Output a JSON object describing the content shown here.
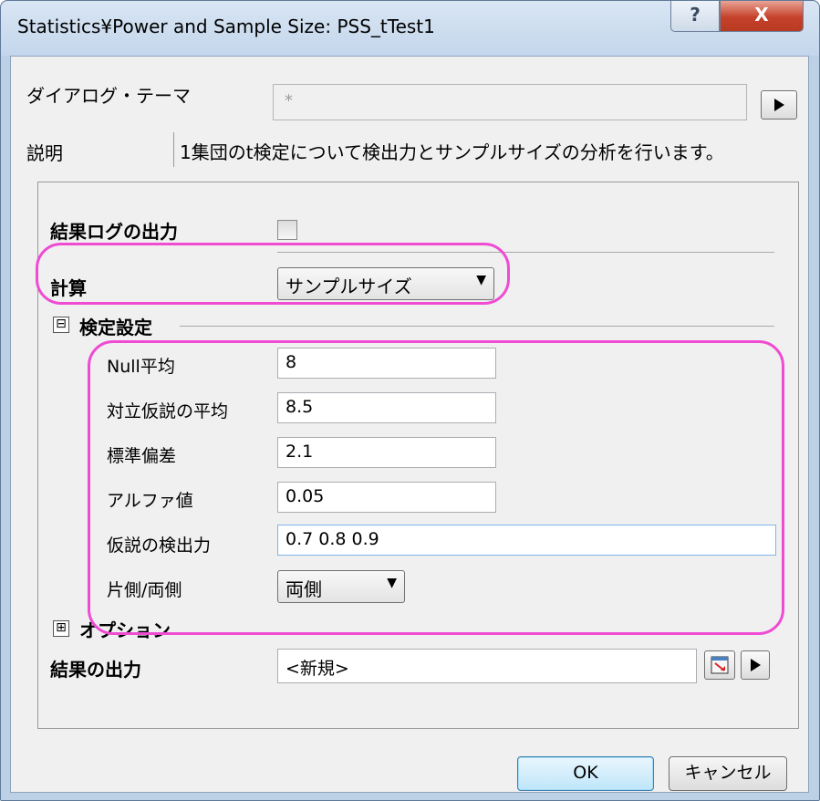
{
  "window": {
    "title": "Statistics¥Power and Sample Size: PSS_tTest1",
    "help_glyph": "?",
    "close_glyph": "X"
  },
  "header": {
    "theme_label": "ダイアログ・テーマ",
    "theme_value": "*",
    "theme_arrow_icon": "play-arrow-icon",
    "description_label": "説明",
    "description_text": "1集団のt検定について検出力とサンプルサイズの分析を行います。"
  },
  "panel": {
    "result_log_label": "結果ログの出力",
    "result_log_checked": false,
    "calc_label": "計算",
    "calc_value": "サンプルサイズ",
    "test_settings": {
      "expander": "⊟",
      "label": "検定設定",
      "fields": {
        "null_mean_label": "Null平均",
        "null_mean_value": "8",
        "alt_mean_label": "対立仮説の平均",
        "alt_mean_value": "8.5",
        "std_dev_label": "標準偏差",
        "std_dev_value": "2.1",
        "alpha_label": "アルファ値",
        "alpha_value": "0.05",
        "power_label": "仮説の検出力",
        "power_value": "0.7 0.8 0.9",
        "tails_label": "片側/両側",
        "tails_value": "両側"
      }
    },
    "options": {
      "expander": "⊞",
      "label": "オプション"
    },
    "output_label": "結果の出力",
    "output_value": "<新規>"
  },
  "footer": {
    "ok_label": "OK",
    "cancel_label": "キャンセル"
  },
  "colors": {
    "highlight": "#ef4bd3",
    "ok_border": "#3c7fb1"
  }
}
